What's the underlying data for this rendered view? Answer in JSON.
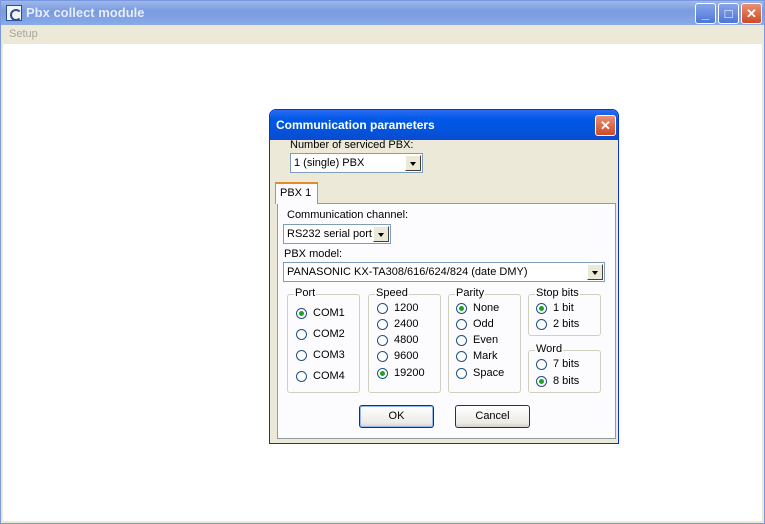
{
  "window": {
    "title": "Pbx collect module"
  },
  "menu": {
    "items": [
      "Setup"
    ]
  },
  "dialog": {
    "title": "Communication parameters",
    "pbx_count": {
      "label": "Number of serviced PBX:",
      "value": "1 (single) PBX"
    },
    "tabs": [
      "PBX 1"
    ],
    "channel": {
      "label": "Communication channel:",
      "value": "RS232 serial port"
    },
    "model": {
      "label": "PBX model:",
      "value": "PANASONIC KX-TA308/616/624/824 (date DMY)"
    },
    "port": {
      "title": "Port",
      "options": [
        "COM1",
        "COM2",
        "COM3",
        "COM4"
      ],
      "selected": "COM1"
    },
    "speed": {
      "title": "Speed",
      "options": [
        "1200",
        "2400",
        "4800",
        "9600",
        "19200"
      ],
      "selected": "19200"
    },
    "parity": {
      "title": "Parity",
      "options": [
        "None",
        "Odd",
        "Even",
        "Mark",
        "Space"
      ],
      "selected": "None"
    },
    "stopbits": {
      "title": "Stop bits",
      "options": [
        "1 bit",
        "2 bits"
      ],
      "selected": "1 bit"
    },
    "word": {
      "title": "Word",
      "options": [
        "7 bits",
        "8 bits"
      ],
      "selected": "8 bits"
    },
    "ok_label": "OK",
    "cancel_label": "Cancel"
  },
  "colors": {
    "dialog_title_bar": "#0058e6",
    "radio_dot": "#21a121",
    "tab_accent": "#e68b2c"
  }
}
